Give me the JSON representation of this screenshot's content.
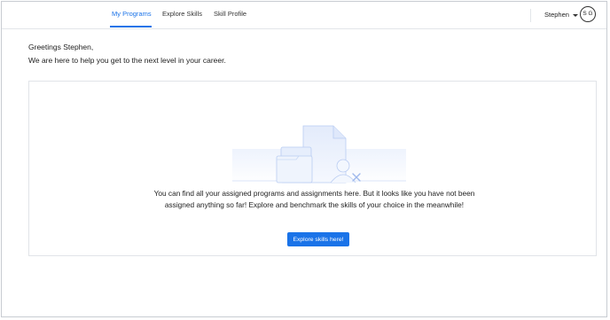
{
  "nav": {
    "tabs": [
      {
        "label": "My Programs",
        "active": true
      },
      {
        "label": "Explore Skills",
        "active": false
      },
      {
        "label": "Skill Profile",
        "active": false
      }
    ],
    "user_name": "Stephen",
    "avatar_initials": "S G"
  },
  "greeting": {
    "line1": "Greetings Stephen,",
    "line2": "We are here to help you get to the next level in your career."
  },
  "empty_state": {
    "illustration_icon": "document-folder-user-icon",
    "message": "You can find all your assigned programs and assignments here. But it looks like you have not been assigned anything so far! Explore and benchmark the skills of your choice in the meanwhile!",
    "cta_label": "Explore skills here!"
  },
  "colors": {
    "accent": "#1a73e8",
    "border": "#e1e4e8",
    "text": "#222222"
  }
}
